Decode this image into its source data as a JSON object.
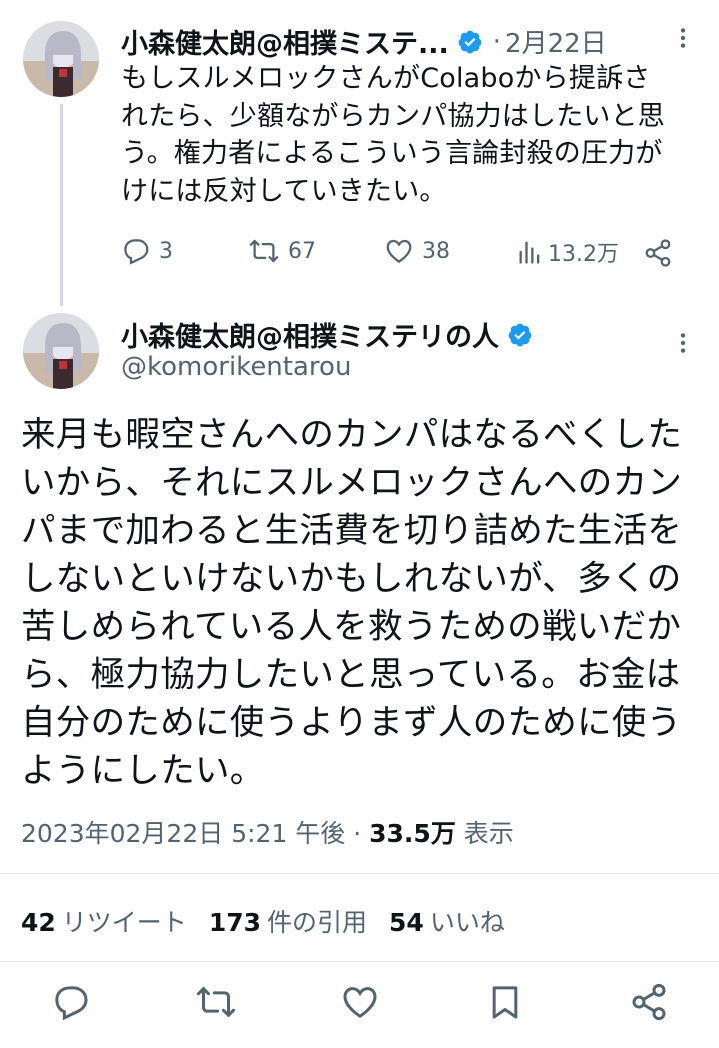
{
  "parent_tweet": {
    "display_name": "小森健太朗@相撲ミステ...",
    "separator": "·",
    "date": "2月22日",
    "text_lines": [
      "もしスルメロックさんがColaboから提訴さ",
      "れたら、少額ながらカンパ協力はしたいと思",
      "う。権力者によるこういう言論封殺の圧力が",
      "けには反対していきたい。"
    ],
    "replies": "3",
    "retweets": "67",
    "likes": "38",
    "views": "13.2万"
  },
  "main_tweet": {
    "display_name": "小森健太朗@相撲ミステリの人",
    "handle": "@komorikentarou",
    "text_lines": [
      "来月も暇空さんへのカンパはなるべくした",
      "いから、それにスルメロックさんへのカン",
      "パまで加わると生活費を切り詰めた生活を",
      "しないといけないかもしれないが、多くの",
      "苦しめられている人を救うための戦いだか",
      "ら、極力協力したいと思っている。お金は",
      "自分のために使うよりまず人のために使う",
      "ようにしたい。"
    ],
    "timestamp": "2023年02月22日 5:21 午後",
    "separator": "·",
    "views_count": "33.5万",
    "views_label": "表示"
  },
  "stats": {
    "retweets_count": "42",
    "retweets_label": "リツイート",
    "quotes_count": "173",
    "quotes_label": "件の引用",
    "likes_count": "54",
    "likes_label": "いいね"
  },
  "colors": {
    "verified": "#1d9bf0",
    "text": "#0f1419",
    "secondary": "#536471"
  },
  "icons": [
    "verified-badge-icon",
    "more-icon",
    "reply-icon",
    "retweet-icon",
    "like-icon",
    "views-icon",
    "share-icon",
    "bookmark-icon"
  ]
}
